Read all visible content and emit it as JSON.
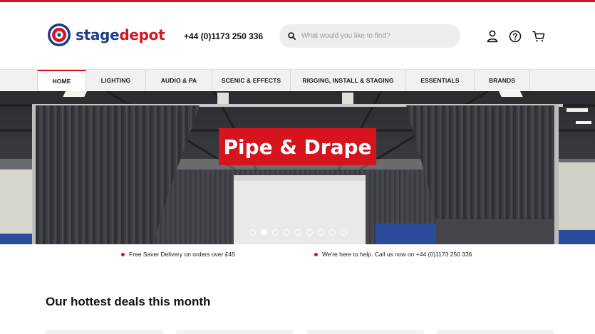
{
  "brand": {
    "name_part1": "stage",
    "name_part2": "depot",
    "colors": {
      "red": "#d7141d",
      "blue": "#1e3a8a"
    }
  },
  "header": {
    "phone": "+44 (0)1173 250 336",
    "search": {
      "placeholder": "What would you like to find?",
      "value": ""
    },
    "icons": [
      "user-icon",
      "help-icon",
      "cart-icon"
    ]
  },
  "nav": {
    "items": [
      {
        "label": "HOME",
        "active": true
      },
      {
        "label": "LIGHTING"
      },
      {
        "label": "AUDIO & PA"
      },
      {
        "label": "SCENIC & EFFECTS"
      },
      {
        "label": "RIGGING, INSTALL & STAGING"
      },
      {
        "label": "ESSENTIALS"
      },
      {
        "label": "BRANDS"
      }
    ]
  },
  "hero": {
    "title": "Pipe & Drape",
    "slides_total": 9,
    "active_slide": 2
  },
  "usps": [
    "Free Saver Delivery on orders over £45",
    "We're here to help. Call us now on +44 (0)1173 250 336"
  ],
  "deals": {
    "heading": "Our hottest deals this month"
  }
}
